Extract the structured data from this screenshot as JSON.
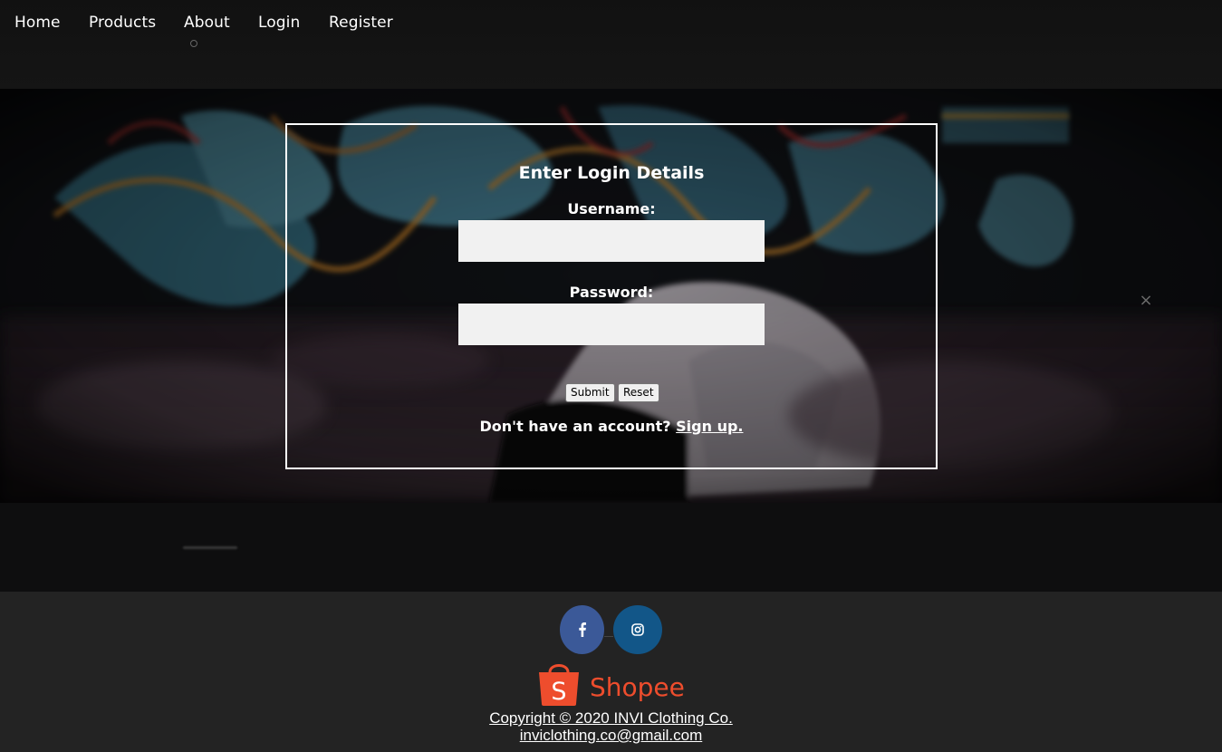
{
  "nav": {
    "items": [
      {
        "label": "Home"
      },
      {
        "label": "Products"
      },
      {
        "label": "About"
      },
      {
        "label": "Login"
      },
      {
        "label": "Register"
      }
    ]
  },
  "login": {
    "title": "Enter Login Details",
    "username_label": "Username:",
    "username_value": "",
    "password_label": "Password:",
    "password_value": "",
    "submit_label": "Submit",
    "reset_label": "Reset",
    "signup_prompt": "Don't have an account?",
    "signup_link": "Sign up."
  },
  "overlay": {
    "close_icon": "close-icon",
    "close_glyph": "×"
  },
  "footer": {
    "social": [
      {
        "name": "facebook-icon",
        "color": "#3b5998"
      },
      {
        "name": "instagram-icon",
        "color": "#125688"
      }
    ],
    "shopee_logo_text": "Shopee",
    "shopee_bag_letter": "S",
    "shopee_color": "#ee4d2d",
    "copyright": "Copyright © 2020 INVI Clothing Co.",
    "email": "inviclothing.co@gmail.com"
  }
}
